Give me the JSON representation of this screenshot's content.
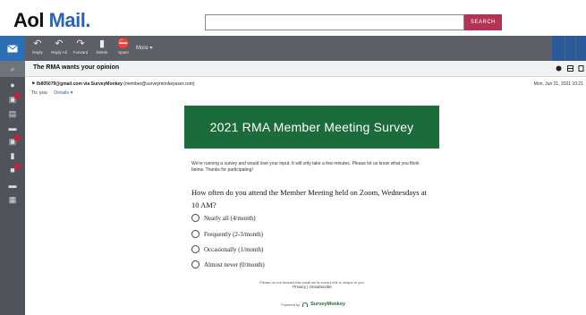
{
  "brand": {
    "aol": "Aol",
    "mail": " Mail."
  },
  "search": {
    "placeholder": "",
    "button_label": "SEARCH"
  },
  "toolbar": {
    "reply": "Reply",
    "reply_all": "Reply All",
    "forward": "Forward",
    "delete": "Delete",
    "spam": "Spam",
    "more": "More"
  },
  "message": {
    "subject": "The RMA wants your opinion",
    "sender": "fb805079@gmail.com via SurveyMonkey",
    "sender_email": "(member@surveymonkeyuser.com)",
    "date": "Mon, Jun 21, 2021 10:21",
    "to": "To: you",
    "details_label": "Details"
  },
  "survey": {
    "title": "2021 RMA Member Meeting Survey",
    "intro": "We're running a survey and would love your input. It will only take a few minutes. Please let us know what you think below. Thanks for participating!",
    "question": "How often do you attend the Member Meeting held on Zoom, Wednesdays at 10 AM?",
    "options": [
      "Nearly all (4/month)",
      "Frequently (2-3/month)",
      "Occasionally (1/month)",
      "Almost never (0/month)"
    ],
    "forward_note": "Please do not forward this email as its survey link is unique to you.",
    "privacy": "Privacy",
    "unsubscribe": "Unsubscribe",
    "powered_by": "Powered by",
    "provider": "SurveyMonkey"
  },
  "colors": {
    "banner": "#1c6b3a",
    "search_button": "#b33355",
    "compose": "#2d6fb4",
    "toolbar": "#5c5f66"
  }
}
